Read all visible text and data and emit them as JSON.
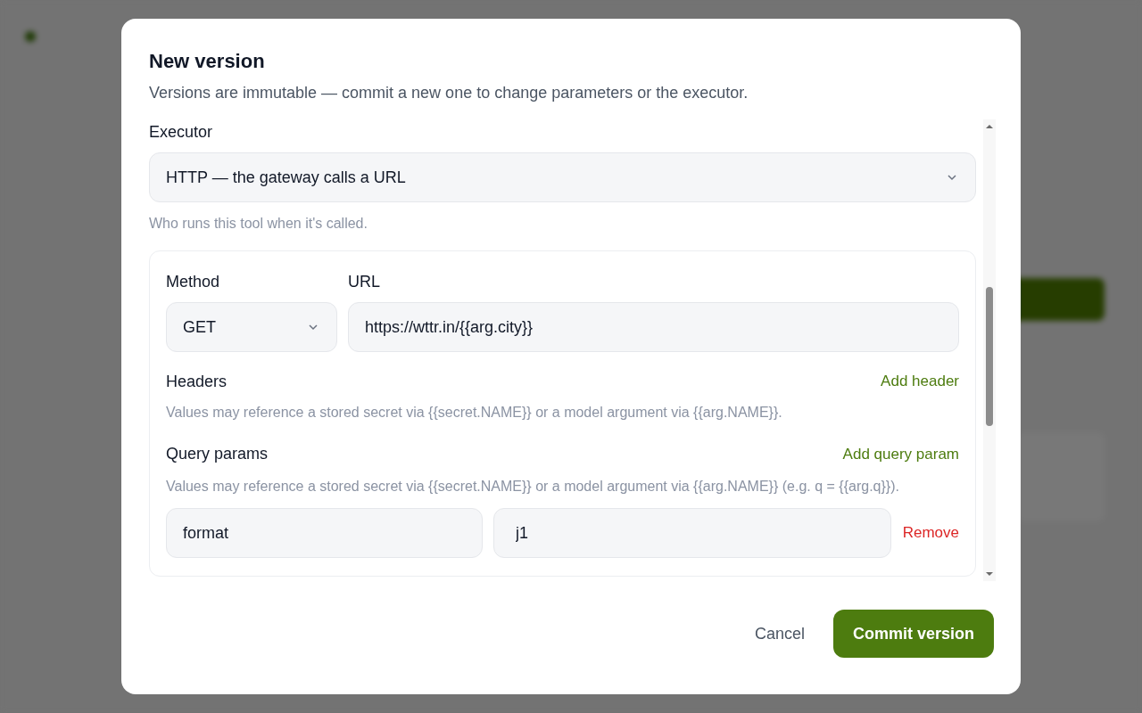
{
  "dialog": {
    "title": "New version",
    "description": "Versions are immutable — commit a new one to change parameters or the executor.",
    "executor": {
      "label": "Executor",
      "value": "HTTP — the gateway calls a URL",
      "hint": "Who runs this tool when it's called."
    },
    "method": {
      "label": "Method",
      "value": "GET"
    },
    "url": {
      "label": "URL",
      "value": "https://wttr.in/{{arg.city}}"
    },
    "headers": {
      "label": "Headers",
      "action": "Add header",
      "hint": "Values may reference a stored secret via {{secret.NAME}} or a model argument via {{arg.NAME}}."
    },
    "query_params": {
      "label": "Query params",
      "action": "Add query param",
      "hint": "Values may reference a stored secret via {{secret.NAME}} or a model argument via {{arg.NAME}} (e.g. q = {{arg.q}}).",
      "rows": [
        {
          "key": "format",
          "value": "j1",
          "remove": "Remove"
        }
      ]
    },
    "buttons": [
      {
        "label": "Cancel",
        "kind": "secondary"
      },
      {
        "label": "Commit version",
        "kind": "primary"
      }
    ]
  }
}
